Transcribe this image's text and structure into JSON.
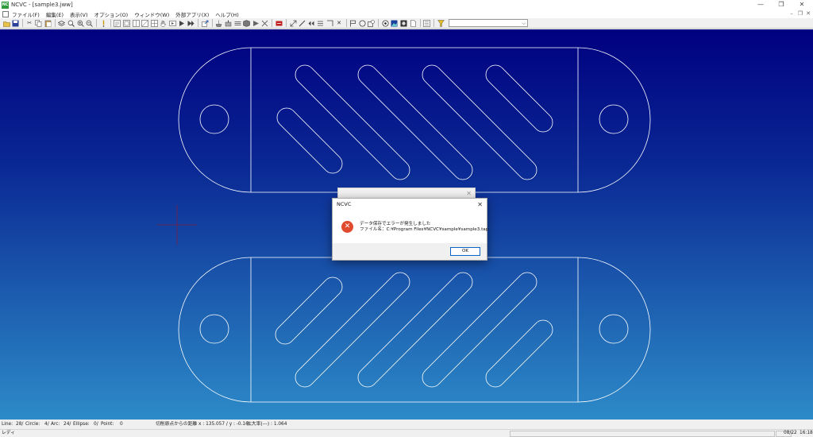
{
  "window": {
    "title": "NCVC - [sample3.jww]",
    "icon_label": "NC",
    "controls": {
      "minimize": "—",
      "restore": "❐",
      "close": "✕"
    }
  },
  "menubar": {
    "items": [
      "ファイル(F)",
      "編集(E)",
      "表示(V)",
      "オプション(O)",
      "ウィンドウ(W)",
      "外部アプリ(X)",
      "ヘルプ(H)"
    ],
    "mdi_controls": {
      "minimize": "–",
      "restore": "❐",
      "close": "✕"
    }
  },
  "toolbar": {
    "select_value": ""
  },
  "dialog_back": {
    "close": "✕"
  },
  "dialog": {
    "title": "NCVC",
    "close": "✕",
    "icon": "error-icon",
    "message_line1": "データ保存でエラーが発生しました",
    "message_line2": "ファイル名：C:¥Program Files¥NCVC¥sample¥sample3.tap",
    "ok_label": "OK"
  },
  "statusbar": {
    "line": "Line:",
    "line_count": "28/",
    "circle": "Circle:",
    "circle_count": "4/",
    "arc": "Arc:",
    "arc_count": "24/",
    "ellipse": "Ellipse:",
    "ellipse_count": "0/",
    "point": "Point:",
    "point_count": "0",
    "distance": "切削原点からの距離  x : 135.057 / y : -0.16",
    "zoom": "拡大率(---) : 1.064"
  },
  "statusbar2": {
    "ready": "レディ",
    "date": "08/22",
    "time": "16:18"
  },
  "colors": {
    "canvas_top": "#000080",
    "canvas_bottom": "#2d8ac8",
    "drawing_lines": "#ffffff",
    "origin_cross": "#7a2040",
    "error": "#e04a2e",
    "ok_border": "#0a64c8"
  }
}
